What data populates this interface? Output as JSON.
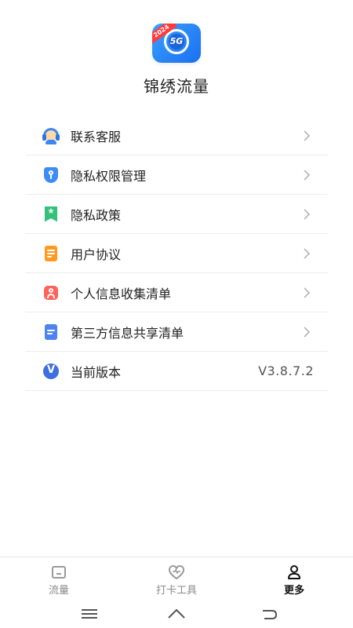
{
  "header": {
    "logo_ribbon_text": "2024",
    "logo_text": "5G",
    "app_name": "锦绣流量"
  },
  "menu": {
    "items": [
      {
        "label": "联系客服",
        "icon": "headset-icon"
      },
      {
        "label": "隐私权限管理",
        "icon": "shield-icon"
      },
      {
        "label": "隐私政策",
        "icon": "ribbon-star-icon"
      },
      {
        "label": "用户协议",
        "icon": "document-icon"
      },
      {
        "label": "个人信息收集清单",
        "icon": "person-icon"
      },
      {
        "label": "第三方信息共享清单",
        "icon": "file-list-icon"
      },
      {
        "label": "当前版本",
        "icon": "version-icon",
        "value": "V3.8.7.2"
      }
    ]
  },
  "tabs": [
    {
      "label": "流量",
      "icon": "home-icon",
      "active": false
    },
    {
      "label": "打卡工具",
      "icon": "heart-icon",
      "active": false
    },
    {
      "label": "更多",
      "icon": "user-icon",
      "active": true
    }
  ],
  "colors": {
    "accent": "#3b86f2",
    "divider": "#ededed",
    "chevron": "#b5b5b5",
    "text_primary": "#222222",
    "tab_inactive": "#8a8a8a",
    "tab_active": "#111111"
  }
}
